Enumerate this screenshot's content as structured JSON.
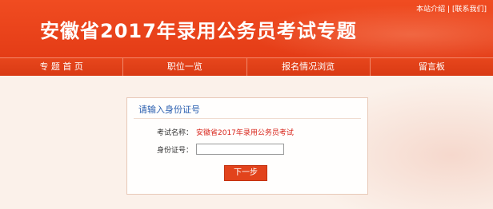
{
  "header": {
    "title": "安徽省2017年录用公务员考试专题",
    "top_links": {
      "about": "本站介绍",
      "contact": "[联系我们]"
    }
  },
  "nav": {
    "items": [
      {
        "label": "专 题 首 页"
      },
      {
        "label": "职位一览"
      },
      {
        "label": "报名情况浏览"
      },
      {
        "label": "留言板"
      }
    ]
  },
  "form": {
    "title": "请输入身份证号",
    "exam_label": "考试名称：",
    "exam_name": "安徽省2017年录用公务员考试",
    "id_label": "身份证号：",
    "id_value": "",
    "submit_label": "下一步"
  },
  "colors": {
    "brand_red": "#e43c16",
    "title_blue": "#2b5fb0",
    "exam_red": "#d8241a"
  }
}
